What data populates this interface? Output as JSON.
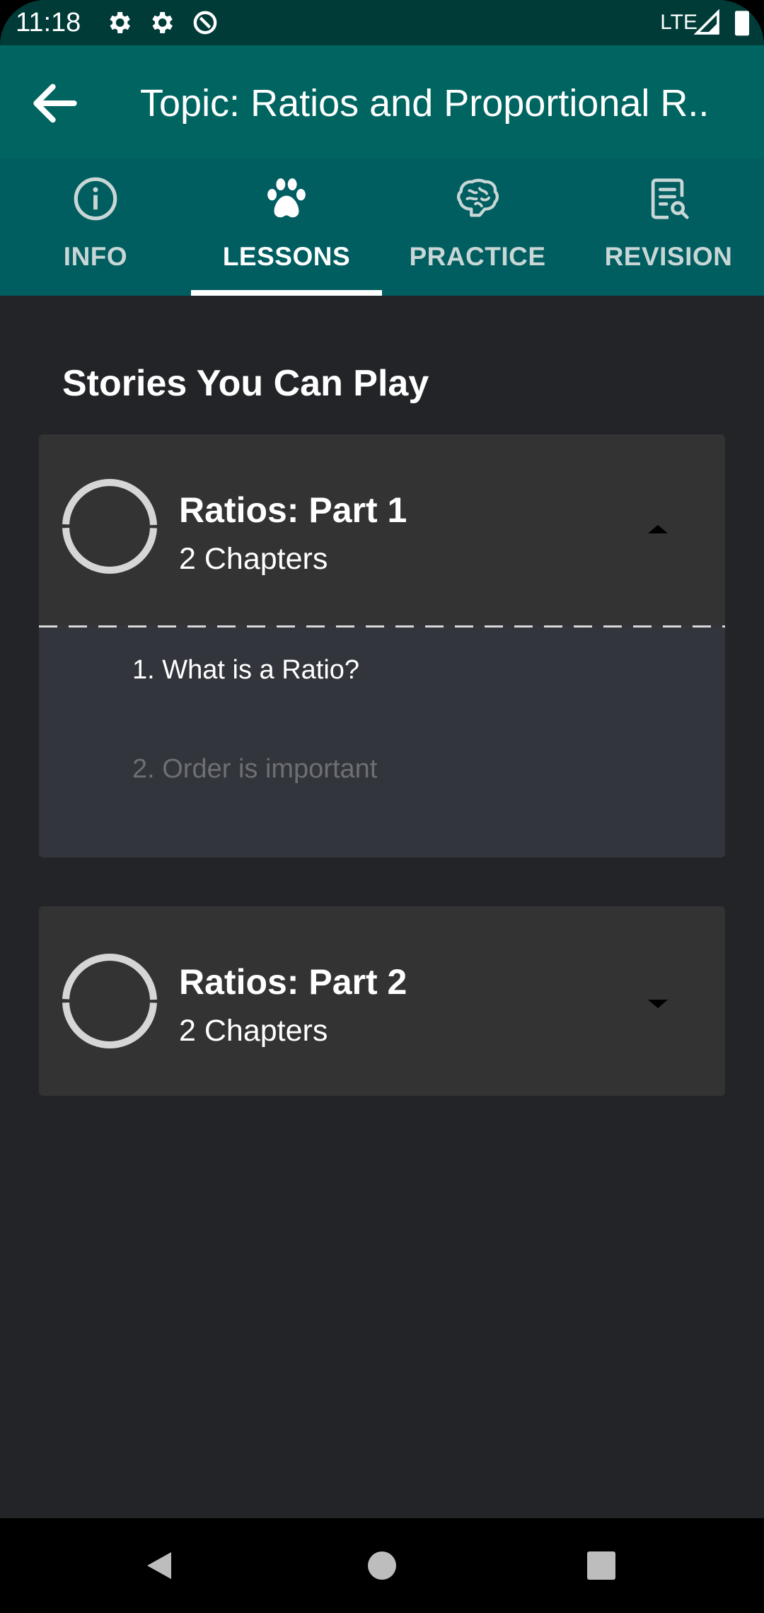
{
  "status_bar": {
    "time": "11:18",
    "network": "LTE",
    "icons": [
      "settings-icon",
      "settings-icon",
      "data-saver-icon",
      "signal-icon",
      "battery-icon"
    ]
  },
  "app_bar": {
    "title": "Topic: Ratios and Proportional R..",
    "back_icon": "arrow-back-icon"
  },
  "tabs": [
    {
      "label": "INFO",
      "icon": "info-icon",
      "active": false
    },
    {
      "label": "LESSONS",
      "icon": "paw-icon",
      "active": true
    },
    {
      "label": "PRACTICE",
      "icon": "brain-icon",
      "active": false
    },
    {
      "label": "REVISION",
      "icon": "revision-doc-icon",
      "active": false
    }
  ],
  "section_title": "Stories You Can Play",
  "stories": [
    {
      "name": "Ratios: Part 1",
      "chapters_label": "2 Chapters",
      "expanded": true,
      "progress": 0,
      "chapters": [
        {
          "title": "1. What is a Ratio?",
          "locked": false
        },
        {
          "title": "2. Order is important",
          "locked": true
        }
      ]
    },
    {
      "name": "Ratios: Part 2",
      "chapters_label": "2 Chapters",
      "expanded": false,
      "progress": 0
    }
  ],
  "colors": {
    "status_bar": "#003b38",
    "app_bar": "#006561",
    "tab_bar": "#005d60",
    "background": "#222427",
    "card": "#333333",
    "chapter_list": "#32353b",
    "locked_text": "#6d6f73"
  },
  "nav_bar": {
    "buttons": [
      "back-triangle-icon",
      "home-circle-icon",
      "recents-square-icon"
    ]
  }
}
